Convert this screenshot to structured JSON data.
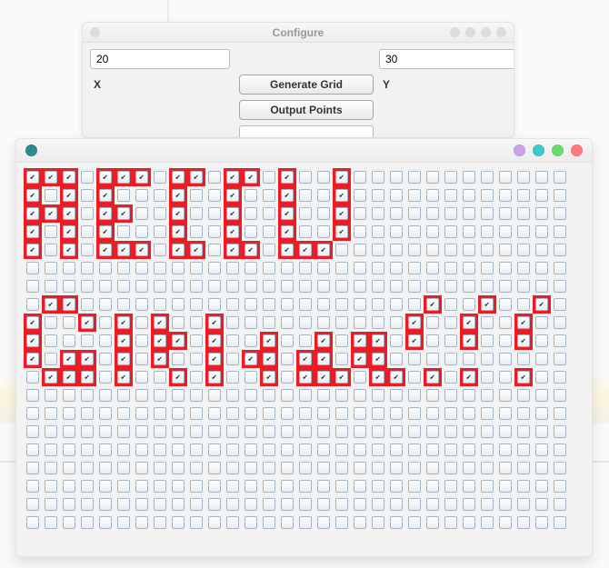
{
  "configure": {
    "title": "Configure",
    "x_value": "20",
    "y_value": "30",
    "x_label": "X",
    "y_label": "Y",
    "generate_label": "Generate Grid",
    "output_label": "Output Points",
    "extra_value": ""
  },
  "grid": {
    "cols": 30,
    "rows": 20,
    "checked_rows": [
      "111.111.11.11.1..1",
      "1.1.1...1..1..1..1",
      "111.11..1..1..1..1",
      "1.1.1...1..1..1..1",
      "1.1.111.11.11.111",
      "",
      "",
      ".11...................1..1..1",
      "1..1.1.1..1..........1..1..1",
      "1....1.11.1..1..1.11.1..1..1",
      "1.11.1.1..1.11.11.11",
      ".111.1..1.1..1.111.11.1.1..1",
      "",
      "",
      "",
      "",
      "",
      "",
      "",
      ""
    ]
  },
  "colors": {
    "highlight": "#ed1c24"
  }
}
